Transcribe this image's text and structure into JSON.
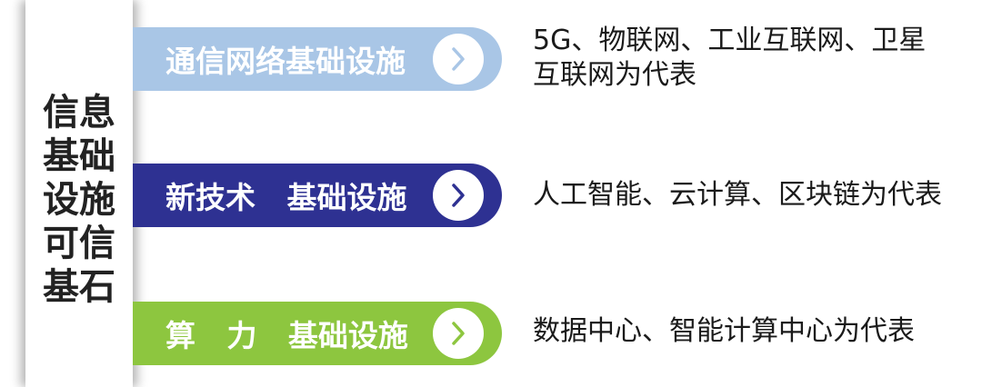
{
  "side_title_lines": [
    "信息",
    "基础",
    "设施",
    "可信",
    "基石"
  ],
  "rows": [
    {
      "label": "通信网络基础设施",
      "color": "#a9c6e6",
      "chevron_color": "#a9c6e6",
      "icon": "chevron-right-icon",
      "description_lines": [
        "5G、物联网、工业互联网、卫星",
        "互联网为代表"
      ]
    },
    {
      "label": "新技术   基础设施",
      "color": "#2e3192",
      "chevron_color": "#2e3192",
      "icon": "chevron-right-icon",
      "description_lines": [
        "人工智能、云计算、区块链为代表"
      ]
    },
    {
      "label": "算   力   基础设施",
      "color": "#8dc63f",
      "chevron_color": "#8dc63f",
      "icon": "chevron-right-icon",
      "description_lines": [
        "数据中心、智能计算中心为代表"
      ]
    }
  ]
}
